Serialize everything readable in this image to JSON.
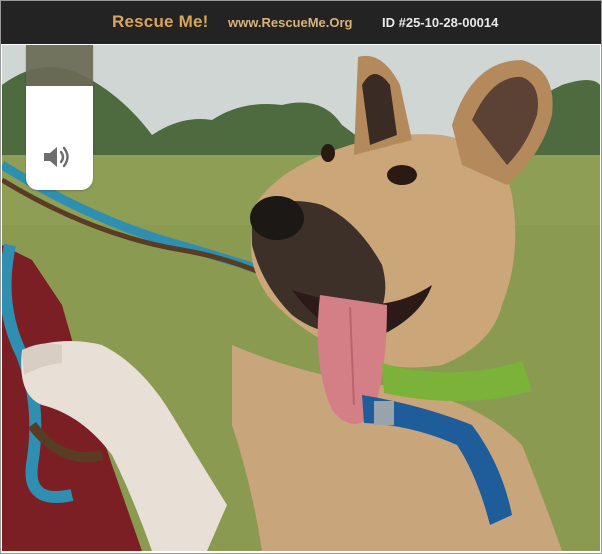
{
  "header": {
    "brand": "Rescue Me!",
    "site": "www.RescueMe.Org",
    "id_text": "ID #25-10-28-00014"
  },
  "media": {
    "volume_level": 0.72,
    "volume_icon": "speaker-volume-icon"
  },
  "colors": {
    "bar": "#232323",
    "brand": "#d9a35a",
    "site": "#d8b27a",
    "id_text": "#e8e8e8"
  }
}
